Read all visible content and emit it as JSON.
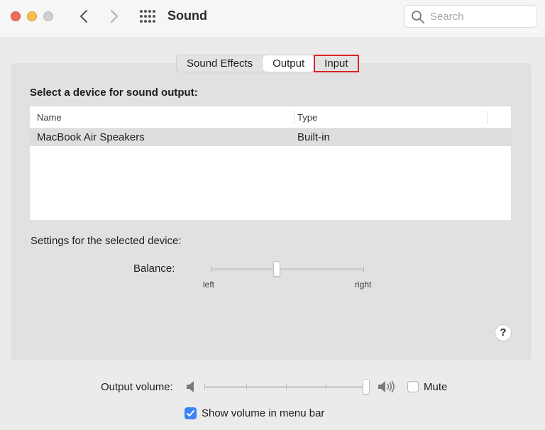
{
  "window": {
    "title": "Sound"
  },
  "search": {
    "placeholder": "Search"
  },
  "tabs": [
    {
      "label": "Sound Effects",
      "selected": false
    },
    {
      "label": "Output",
      "selected": true
    },
    {
      "label": "Input",
      "selected": false,
      "highlighted": true
    }
  ],
  "output": {
    "section_title": "Select a device for sound output:",
    "columns": [
      "Name",
      "Type"
    ],
    "devices": [
      {
        "name": "MacBook Air Speakers",
        "type": "Built-in",
        "selected": true
      }
    ],
    "settings_label": "Settings for the selected device:",
    "balance": {
      "label": "Balance:",
      "left": "left",
      "right": "right",
      "value": 0.5
    }
  },
  "help": {
    "label": "?"
  },
  "volume": {
    "label": "Output volume:",
    "level": 1.0,
    "mute_label": "Mute",
    "mute_checked": false
  },
  "menu_bar": {
    "label": "Show volume in menu bar",
    "checked": true
  },
  "colors": {
    "highlight_outline": "#d8232a",
    "checkbox_accent": "#3b82f6",
    "close": "#ed6a5e",
    "minimize": "#f5bf4f",
    "zoom": "#cfcfcf"
  },
  "icons": {
    "back": "chevron-left-icon",
    "forward": "chevron-right-icon",
    "show_all": "grid-icon",
    "search": "search-icon",
    "speaker_low": "speaker-low-icon",
    "speaker_high": "speaker-high-icon",
    "help": "question-icon",
    "check": "checkmark-icon"
  }
}
